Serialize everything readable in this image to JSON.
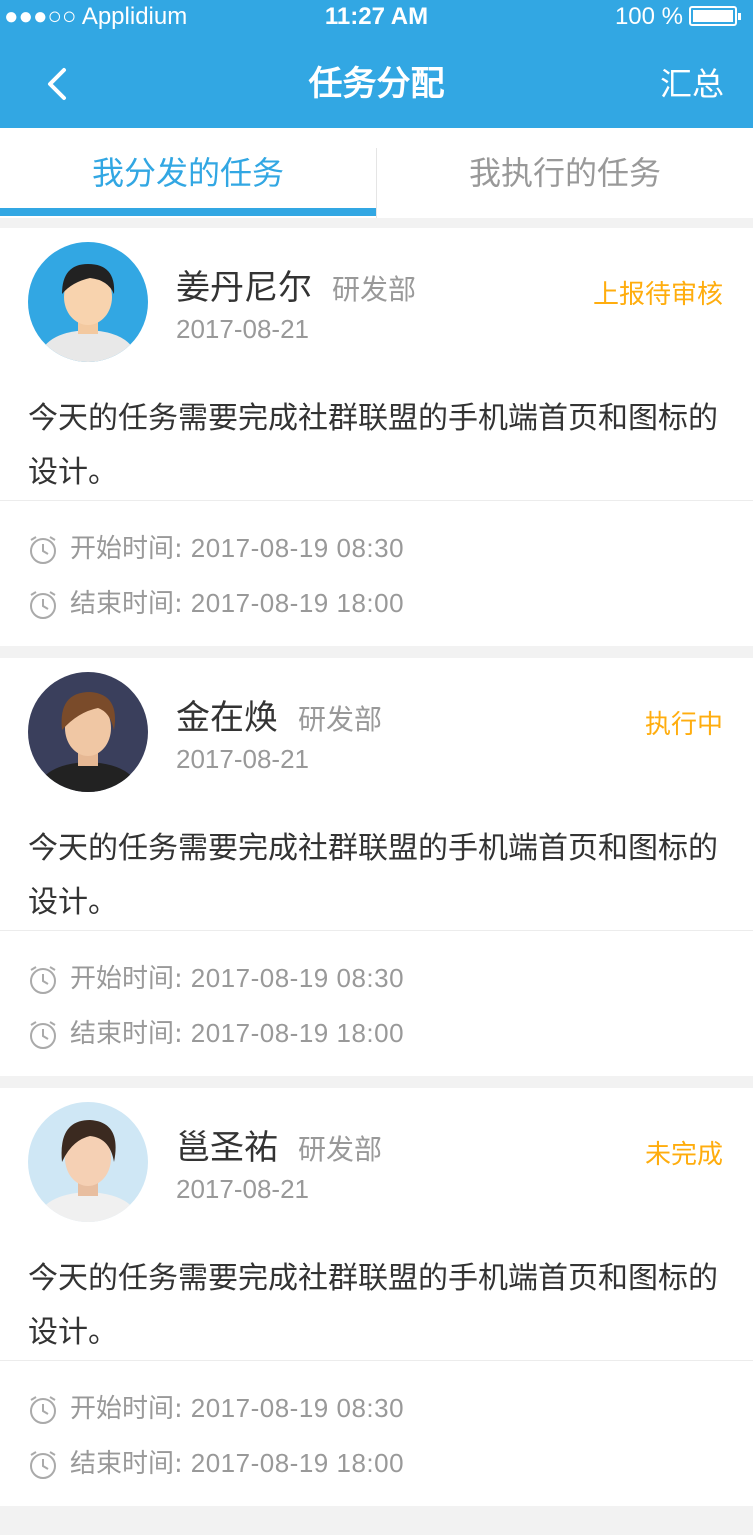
{
  "status_bar": {
    "carrier": "●●●○○ Applidium",
    "time": "11:27 AM",
    "battery": "100 %"
  },
  "nav": {
    "title": "任务分配",
    "right_label": "汇总",
    "back_icon": "chevron-left-icon"
  },
  "tabs": [
    {
      "label": "我分发的任务",
      "active": true
    },
    {
      "label": "我执行的任务",
      "active": false
    }
  ],
  "colors": {
    "primary": "#32a7e3",
    "accent": "#ffad0e",
    "text": "#333333",
    "muted": "#999999"
  },
  "tasks": [
    {
      "name": "姜丹尼尔",
      "dept": "研发部",
      "date": "2017-08-21",
      "status": "上报待审核",
      "description": "今天的任务需要完成社群联盟的手机端首页和图标的设计。",
      "start_label": "开始时间:",
      "start_value": "2017-08-19  08:30",
      "end_label": "结束时间:",
      "end_value": "2017-08-19  18:00"
    },
    {
      "name": "金在焕",
      "dept": "研发部",
      "date": "2017-08-21",
      "status": "执行中",
      "description": "今天的任务需要完成社群联盟的手机端首页和图标的设计。",
      "start_label": "开始时间:",
      "start_value": "2017-08-19  08:30",
      "end_label": "结束时间:",
      "end_value": "2017-08-19  18:00"
    },
    {
      "name": "邕圣祐",
      "dept": "研发部",
      "date": "2017-08-21",
      "status": "未完成",
      "description": "今天的任务需要完成社群联盟的手机端首页和图标的设计。",
      "start_label": "开始时间:",
      "start_value": "2017-08-19  08:30",
      "end_label": "结束时间:",
      "end_value": "2017-08-19  18:00"
    }
  ]
}
